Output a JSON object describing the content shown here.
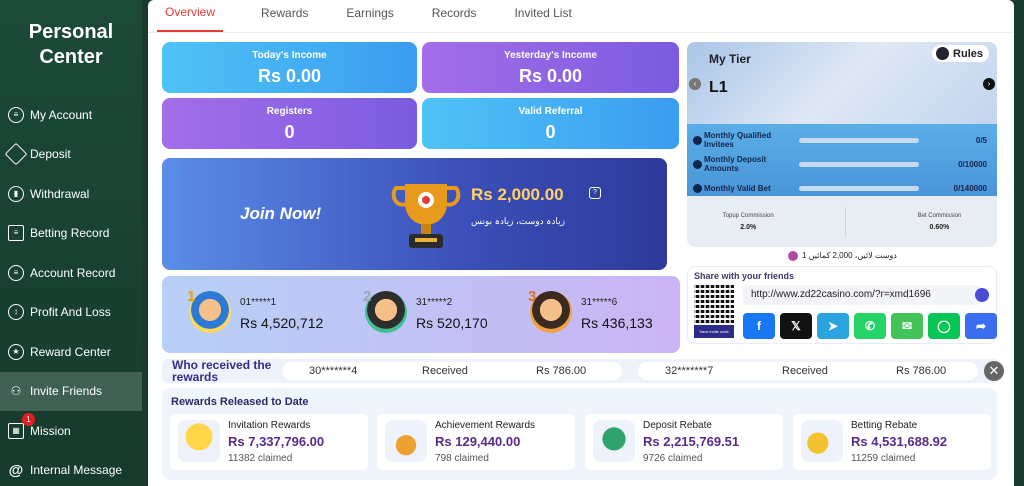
{
  "sidebar": {
    "title_line1": "Personal",
    "title_line2": "Center",
    "items": [
      {
        "label": "My Account",
        "icon": "account-icon"
      },
      {
        "label": "Deposit",
        "icon": "deposit-icon"
      },
      {
        "label": "Withdrawal",
        "icon": "withdrawal-icon"
      },
      {
        "label": "Betting Record",
        "icon": "betting-record-icon"
      },
      {
        "label": "Account Record",
        "icon": "account-record-icon"
      },
      {
        "label": "Profit And Loss",
        "icon": "profit-loss-icon"
      },
      {
        "label": "Reward Center",
        "icon": "reward-center-icon"
      },
      {
        "label": "Invite Friends",
        "icon": "invite-friends-icon"
      },
      {
        "label": "Mission",
        "icon": "gift-icon",
        "badge": "1"
      },
      {
        "label": "Internal Message",
        "icon": "at-icon"
      }
    ]
  },
  "tabs": [
    "Overview",
    "Rewards",
    "Earnings",
    "Records",
    "Invited List"
  ],
  "stats": {
    "today_income_label": "Today's Income",
    "today_income_value": "Rs  0.00",
    "yesterday_income_label": "Yesterday's Income",
    "yesterday_income_value": "Rs  0.00",
    "registers_label": "Registers",
    "registers_value": "0",
    "valid_referral_label": "Valid Referral",
    "valid_referral_value": "0"
  },
  "join": {
    "cta": "Join Now!",
    "amount": "Rs  2,000.00",
    "subtitle": "زیادہ دوست، زیادہ بونس"
  },
  "ranking": [
    {
      "rank": "1",
      "name": "01*****1",
      "amount": "Rs 4,520,712"
    },
    {
      "rank": "2",
      "name": "31*****2",
      "amount": "Rs 520,170"
    },
    {
      "rank": "3",
      "name": "31*****6",
      "amount": "Rs 436,133"
    }
  ],
  "tier": {
    "title": "My Tier",
    "level": "L1",
    "rules_label": "Rules",
    "progress": [
      {
        "label": "Monthly Qualified Invitees",
        "value": "0/5",
        "fraction": 0
      },
      {
        "label": "Monthly Deposit Amounts",
        "value": "0/10000",
        "fraction": 0
      },
      {
        "label": "Monthly Valid Bet",
        "value": "0/140000",
        "fraction": 0
      }
    ],
    "topup_commission_label": "Topup Commission",
    "topup_commission_value": "2.0%",
    "bet_commission_label": "Bet Commission",
    "bet_commission_value": "0.60%",
    "below_text": "دوست لائیں، 2,000 کمائیں 1"
  },
  "share": {
    "title": "Share with your friends",
    "qr_label": "Save invite code",
    "link": "http://www.zd22casino.com/?r=xmd1696",
    "buttons": [
      {
        "name": "facebook",
        "glyph": "f",
        "color": "#1877f2"
      },
      {
        "name": "x",
        "glyph": "𝕏",
        "color": "#111111"
      },
      {
        "name": "telegram",
        "glyph": "➤",
        "color": "#2aa3df"
      },
      {
        "name": "whatsapp",
        "glyph": "✆",
        "color": "#25d366"
      },
      {
        "name": "sms",
        "glyph": "✉",
        "color": "#43c25a"
      },
      {
        "name": "line",
        "glyph": "◯",
        "color": "#06c755"
      },
      {
        "name": "share",
        "glyph": "➦",
        "color": "#3a6df0"
      }
    ]
  },
  "ticker": {
    "title_line1": "Who received the",
    "title_line2": "rewards",
    "entries": [
      {
        "user": "30*******4",
        "status": "Received",
        "amount": "Rs   786.00"
      },
      {
        "user": "32*******7",
        "status": "Received",
        "amount": "Rs   786.00"
      }
    ]
  },
  "released": {
    "title": "Rewards Released to Date",
    "cards": [
      {
        "title": "Invitation Rewards",
        "amount": "Rs  7,337,796.00",
        "claimed": "11382 claimed",
        "icon": "star-hand-icon"
      },
      {
        "title": "Achievement Rewards",
        "amount": "Rs  129,440.00",
        "claimed": "798 claimed",
        "icon": "medal-icon"
      },
      {
        "title": "Deposit Rebate",
        "amount": "Rs  2,215,769.51",
        "claimed": "9726 claimed",
        "icon": "money-bag-icon"
      },
      {
        "title": "Betting Rebate",
        "amount": "Rs  4,531,688.92",
        "claimed": "11259 claimed",
        "icon": "coins-icon"
      }
    ]
  }
}
